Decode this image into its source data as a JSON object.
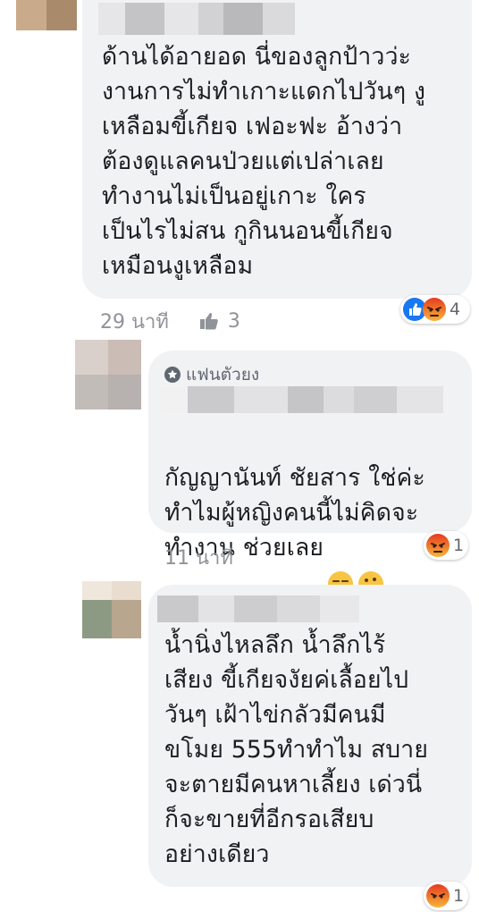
{
  "comments": [
    {
      "text": "ด้านได้อายอด นี่ของลูกป้าวว่ะ\nงานการไม่ทำเกาะแดกไปวันๆ งู\nเหลือมขี้เกียจ เฟอะฟะ อ้างว่า\nต้องดูแลคนป่วยแต่เปล่าเลย\nทำงานไม่เป็นอยู่เกาะ ใคร\nเป็นไรไม่สน กูกินนอนขี้เกียจ\nเหมือนงูเหลือม",
      "time": "29 นาที",
      "likes": "3",
      "reaction_count": "4"
    },
    {
      "badge": "แฟนตัวยง",
      "text": "กัญญานันท์ ชัยสาร ใช่ค่ะ\nทำไมผู้หญิงคนนี้ไม่คิดจะ\nทำงาน ช่วยเลย",
      "time": "11 นาที",
      "reaction_count": "1"
    },
    {
      "text": "น้ำนิ่งไหลลึก น้ำลึกไร้\nเสียง ขี้เกียจงัยค่เลื้อยไป\nวันๆ เฝ้าไข่กลัวมีคนมี\nขโมย 555ทำทำไม สบาย\nจะตายมีคนหาเลี้ยง เด่วนี่\nก็จะขายที่อีกรอเสียบ\nอย่างเดียว",
      "reaction_count": "1"
    }
  ],
  "colors": {
    "bubble": "#f1f2f4",
    "meta_text": "#909399",
    "like_blue": "#1877f2",
    "angry_orange": "#f0582b"
  }
}
